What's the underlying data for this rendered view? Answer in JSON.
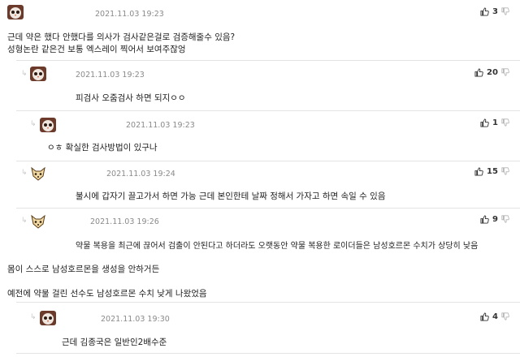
{
  "comments": [
    {
      "timestamp": "2021.11.03 19:23",
      "likes": "3",
      "lines": [
        "근데 약은 했다 안했다를 의사가 검사같은걸로 검증해줄수 있음?",
        "성형논란 같은건 보통 엑스레이 찍어서 보여주잖엉"
      ],
      "avatar": "owl-avatar"
    },
    {
      "timestamp": "2021.11.03 19:23",
      "likes": "20",
      "lines": [
        "피검사 오줌검사 하면 되지ㅇㅇ"
      ],
      "avatar": "owl-avatar"
    },
    {
      "timestamp": "2021.11.03 19:23",
      "likes": "1",
      "lines": [
        "ㅇㅎ 확실한 검사방법이 있구나"
      ],
      "avatar": "owl-avatar"
    },
    {
      "timestamp": "2021.11.03 19:24",
      "likes": "15",
      "lines": [
        "불시에 갑자기 끌고가서 하면 가능 근데 본인한테 날짜 정해서 가자고 하면 속일 수 있음"
      ],
      "avatar": "fox-avatar"
    },
    {
      "timestamp": "2021.11.03 19:26",
      "likes": "9",
      "lines": [
        "약물 복용을 최근에 끊어서 검출이 안된다고 하더라도 오랫동안 약물 복용한 로이더들은 남성호르몬 수치가 상당히 낮음",
        "몸이 스스로 남성호르몬을 생성을 안하거든",
        "예전에 약물 걸린 선수도 남성호르몬 수치 낮게 나왔었음"
      ],
      "avatar": "fox-avatar"
    },
    {
      "timestamp": "2021.11.03 19:30",
      "likes": "4",
      "lines": [
        "근데 김종국은 일반인2배수준"
      ],
      "avatar": "owl-avatar"
    }
  ],
  "colors": {
    "separator": "#e4e4e4",
    "timestamp": "#8a8a8a",
    "text": "#1e1e1e"
  },
  "icons": {
    "like": "thumbs-up-icon",
    "dislike": "thumbs-down-icon",
    "reply": "reply-arrow-icon"
  }
}
